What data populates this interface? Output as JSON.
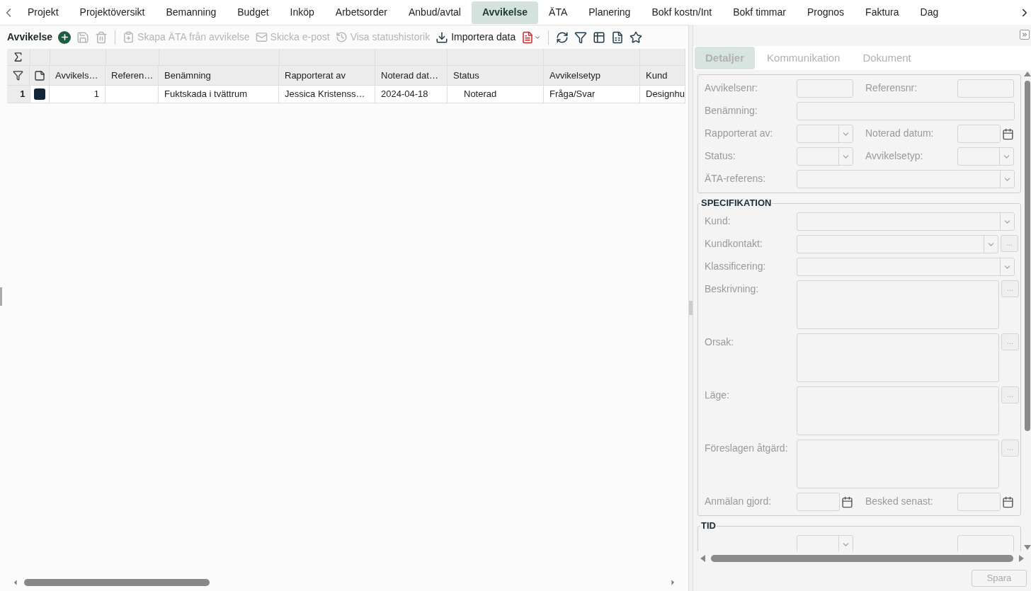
{
  "tabs": [
    {
      "label": "Projekt",
      "selected": false
    },
    {
      "label": "Projektöversikt",
      "selected": false
    },
    {
      "label": "Bemanning",
      "selected": false
    },
    {
      "label": "Budget",
      "selected": false
    },
    {
      "label": "Inköp",
      "selected": false
    },
    {
      "label": "Arbetsorder",
      "selected": false
    },
    {
      "label": "Anbud/avtal",
      "selected": false
    },
    {
      "label": "Avvikelse",
      "selected": true
    },
    {
      "label": "ÄTA",
      "selected": false
    },
    {
      "label": "Planering",
      "selected": false
    },
    {
      "label": "Bokf kostn/Int",
      "selected": false
    },
    {
      "label": "Bokf timmar",
      "selected": false
    },
    {
      "label": "Prognos",
      "selected": false
    },
    {
      "label": "Faktura",
      "selected": false
    },
    {
      "label": "Dag",
      "selected": false
    }
  ],
  "toolbar": {
    "title": "Avvikelse",
    "actions": [
      {
        "kind": "add",
        "disabled": false
      },
      {
        "kind": "save",
        "disabled": true
      },
      {
        "kind": "delete",
        "disabled": true
      },
      {
        "kind": "create",
        "label": "Skapa ÄTA från avvikelse",
        "disabled": true
      },
      {
        "kind": "mail",
        "label": "Skicka e-post",
        "disabled": true
      },
      {
        "kind": "history",
        "label": "Visa statushistorik",
        "disabled": true
      },
      {
        "kind": "import",
        "label": "Importera data",
        "disabled": false
      },
      {
        "kind": "pdf",
        "disabled": false
      },
      {
        "kind": "refresh",
        "disabled": false
      },
      {
        "kind": "filter",
        "disabled": false
      },
      {
        "kind": "columns",
        "disabled": false
      },
      {
        "kind": "excel",
        "disabled": false
      },
      {
        "kind": "star",
        "disabled": false
      }
    ]
  },
  "table": {
    "columns": [
      "Avvikels…",
      "Referen…",
      "Benämning",
      "Rapporterat av",
      "Noterad dat…",
      "Status",
      "Avvikelsetyp",
      "Kund"
    ],
    "rows": [
      {
        "number": "1",
        "cells": [
          "1",
          "",
          "Fuktskada i tvättrum",
          "Jessica Kristenss…",
          "2024-04-18",
          "Noterad",
          "Fråga/Svar",
          "Designhu"
        ]
      }
    ]
  },
  "detail_tabs": [
    {
      "label": "Detaljer",
      "selected": true
    },
    {
      "label": "Kommunikation",
      "selected": false
    },
    {
      "label": "Dokument",
      "selected": false
    }
  ],
  "sections": [
    {
      "rows": [
        [
          {
            "label": "Avvikelsenr:",
            "kind": "text"
          },
          {
            "label": "Referensnr:",
            "kind": "text"
          }
        ],
        [
          {
            "label": "Benämning:",
            "kind": "wide-text"
          }
        ],
        [
          {
            "label": "Rapporterat av:",
            "kind": "select"
          },
          {
            "label": "Noterad datum:",
            "kind": "date"
          }
        ],
        [
          {
            "label": "Status:",
            "kind": "select"
          },
          {
            "label": "Avvikelsetyp:",
            "kind": "select"
          }
        ],
        [
          {
            "label": "ÄTA-referens:",
            "kind": "wide-select"
          }
        ]
      ]
    },
    {
      "title": "SPECIFIKATION",
      "rows": [
        [
          {
            "label": "Kund:",
            "kind": "wide-select"
          }
        ],
        [
          {
            "label": "Kundkontakt:",
            "kind": "wide-select",
            "more": "..."
          }
        ],
        [
          {
            "label": "Klassificering:",
            "kind": "wide-select"
          }
        ],
        [
          {
            "label": "Beskrivning:",
            "kind": "textarea",
            "more": "..."
          }
        ],
        [
          {
            "label": "Orsak:",
            "kind": "textarea",
            "more": "..."
          }
        ],
        [
          {
            "label": "Läge:",
            "kind": "textarea",
            "more": "..."
          }
        ],
        [
          {
            "label": "Föreslagen åtgärd:",
            "kind": "textarea",
            "more": "..."
          }
        ],
        [
          {
            "label": "Anmälan gjord:",
            "kind": "date"
          },
          {
            "label": "Besked senast:",
            "kind": "date"
          }
        ]
      ]
    },
    {
      "title": "TID",
      "rows": [
        [
          {
            "kind": "select"
          },
          {
            "kind": "text"
          }
        ]
      ]
    }
  ],
  "save_button": {
    "label": "Spara",
    "disabled": true
  }
}
